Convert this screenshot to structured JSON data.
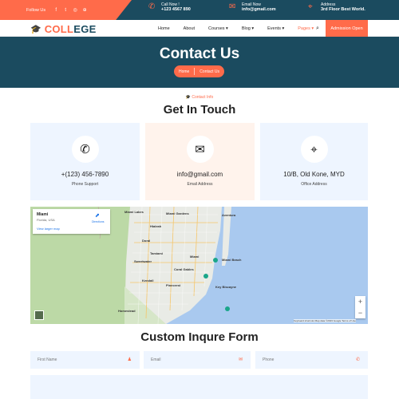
{
  "topbar": {
    "follow_label": "Follow Us",
    "social": [
      "f",
      "t",
      "i",
      "p"
    ],
    "call_label": "Call Now !",
    "call_value": "+123 4567 890",
    "email_label": "Email Now",
    "email_value": "info@gmail.com",
    "address_label": "Address",
    "address_value": "3rd Floor Best World."
  },
  "nav": {
    "logo_part1": "COLL",
    "logo_part2": "EGE",
    "items": [
      "Home",
      "About",
      "Courses ▾",
      "Blog ▾",
      "Events ▾",
      "Pages ▾"
    ],
    "cta": "Admission Open"
  },
  "hero": {
    "title": "Contact Us",
    "crumb_home": "Home",
    "crumb_current": "Contact Us"
  },
  "section": {
    "eyebrow": "Contact Info",
    "heading": "Get In Touch"
  },
  "cards": [
    {
      "value": "+(123) 456-7890",
      "label": "Phone Support",
      "icon": "phone-icon",
      "bg": "#eef5ff"
    },
    {
      "value": "info@gmail.com",
      "label": "Email Address",
      "icon": "envelope-icon",
      "bg": "#fff3ec"
    },
    {
      "value": "10/B, Old Kone, MYD",
      "label": "Office Address",
      "icon": "location-pin-icon",
      "bg": "#eef5ff"
    }
  ],
  "map": {
    "place": "Miami",
    "region": "Florida, USA",
    "larger_map": "View larger map",
    "directions": "Directions",
    "footer": "Keyboard shortcuts   Map data ©2023 Google   Terms of Use",
    "labels": [
      "Miami Lakes",
      "Hialeah",
      "Miami Gardens",
      "Aventura",
      "Miami",
      "Miami Beach",
      "Kendall",
      "Pinecrest",
      "Coral Gables",
      "Doral",
      "Sweetwater",
      "Key Biscayne",
      "Homestead",
      "Tamiami"
    ]
  },
  "form": {
    "heading": "Custom Inqure Form",
    "first_name": "First Name",
    "email": "Email",
    "phone": "Phone"
  },
  "colors": {
    "accent": "#ff6b4a",
    "brand": "#1b4b5f"
  }
}
